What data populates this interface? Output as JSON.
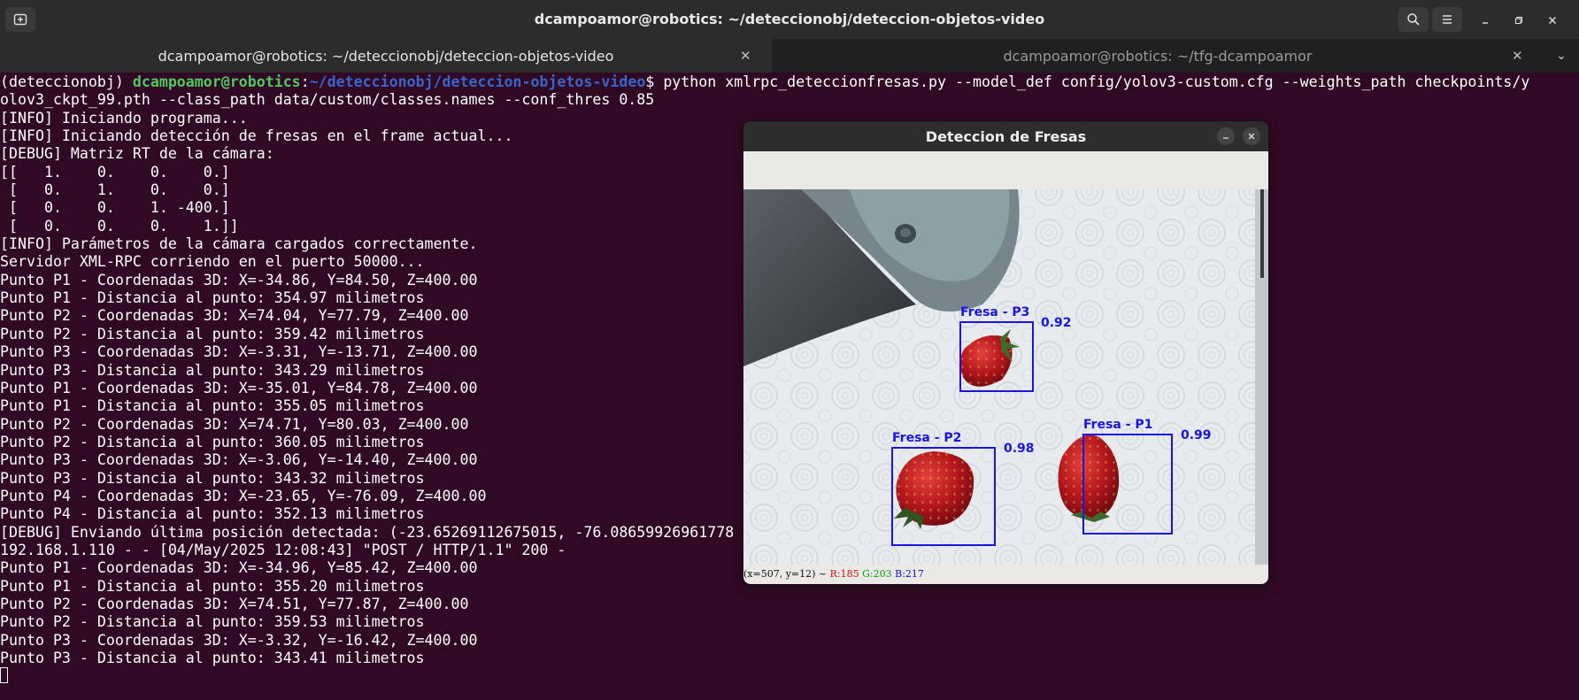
{
  "titlebar": {
    "title": "dcampoamor@robotics: ~/deteccionobj/deteccion-objetos-video"
  },
  "tabs": [
    {
      "label": "dcampoamor@robotics: ~/deteccionobj/deteccion-objetos-video",
      "active": true
    },
    {
      "label": "dcampoamor@robotics: ~/tfg-dcampoamor",
      "active": false
    }
  ],
  "terminal": {
    "prompt_env": "(deteccionobj) ",
    "prompt_user": "dcampoamor@robotics",
    "prompt_sep": ":",
    "prompt_path": "~/deteccionobj/deteccion-objetos-video",
    "prompt_symbol": "$ ",
    "command": "python xmlrpc_deteccionfresas.py --model_def config/yolov3-custom.cfg --weights_path checkpoints/y",
    "command_cont": "olov3_ckpt_99.pth --class_path data/custom/classes.names --conf_thres 0.85",
    "lines": [
      "[INFO] Iniciando programa...",
      "[INFO] Iniciando detección de fresas en el frame actual...",
      "[DEBUG] Matriz RT de la cámara:",
      "[[   1.    0.    0.    0.]",
      " [   0.    1.    0.    0.]",
      " [   0.    0.    1. -400.]",
      " [   0.    0.    0.    1.]]",
      "[INFO] Parámetros de la cámara cargados correctamente.",
      "Servidor XML-RPC corriendo en el puerto 50000...",
      "Punto P1 - Coordenadas 3D: X=-34.86, Y=84.50, Z=400.00",
      "Punto P1 - Distancia al punto: 354.97 milimetros",
      "Punto P2 - Coordenadas 3D: X=74.04, Y=77.79, Z=400.00",
      "Punto P2 - Distancia al punto: 359.42 milimetros",
      "Punto P3 - Coordenadas 3D: X=-3.31, Y=-13.71, Z=400.00",
      "Punto P3 - Distancia al punto: 343.29 milimetros",
      "Punto P1 - Coordenadas 3D: X=-35.01, Y=84.78, Z=400.00",
      "Punto P1 - Distancia al punto: 355.05 milimetros",
      "Punto P2 - Coordenadas 3D: X=74.71, Y=80.03, Z=400.00",
      "Punto P2 - Distancia al punto: 360.05 milimetros",
      "Punto P3 - Coordenadas 3D: X=-3.06, Y=-14.40, Z=400.00",
      "Punto P3 - Distancia al punto: 343.32 milimetros",
      "Punto P4 - Coordenadas 3D: X=-23.65, Y=-76.09, Z=400.00",
      "Punto P4 - Distancia al punto: 352.13 milimetros",
      "[DEBUG] Enviando última posición detectada: (-23.65269112675015, -76.08659926961778",
      "192.168.1.110 - - [04/May/2025 12:08:43] \"POST / HTTP/1.1\" 200 -",
      "Punto P1 - Coordenadas 3D: X=-34.96, Y=85.42, Z=400.00",
      "Punto P1 - Distancia al punto: 355.20 milimetros",
      "Punto P2 - Coordenadas 3D: X=74.51, Y=77.87, Z=400.00",
      "Punto P2 - Distancia al punto: 359.53 milimetros",
      "Punto P3 - Coordenadas 3D: X=-3.32, Y=-16.42, Z=400.00",
      "Punto P3 - Distancia al punto: 343.41 milimetros"
    ]
  },
  "cv_window": {
    "title": "Deteccion de Fresas",
    "detections": [
      {
        "label": "Fresa - P3",
        "score": "0.92"
      },
      {
        "label": "Fresa - P2",
        "score": "0.98"
      },
      {
        "label": "Fresa - P1",
        "score": "0.99"
      }
    ],
    "status": {
      "coords": "(x=507, y=12) ~ ",
      "r": "R:185",
      "g": "G:203",
      "b": "B:217"
    },
    "box_color": "#1a14e0"
  }
}
